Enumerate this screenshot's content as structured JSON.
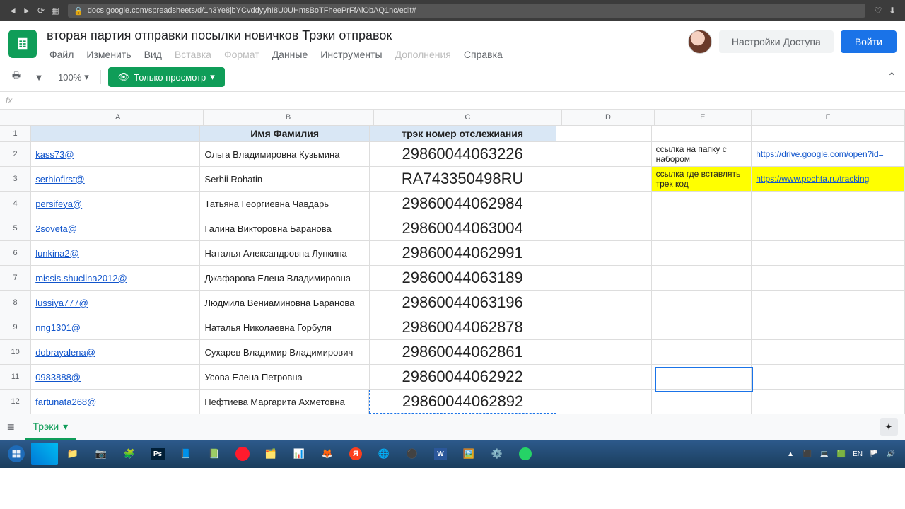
{
  "browser": {
    "url": "docs.google.com/spreadsheets/d/1h3Ye8jbYCvddyyhI8U0UHmsBoTFheePrFfAlObAQ1nc/edit#"
  },
  "doc": {
    "title": "вторая партия отправки посылки новичков Трэки отправок",
    "menus": [
      "Файл",
      "Изменить",
      "Вид",
      "Вставка",
      "Формат",
      "Данные",
      "Инструменты",
      "Дополнения",
      "Справка"
    ],
    "disabled_menus": [
      "Вставка",
      "Формат",
      "Дополнения"
    ],
    "share": "Настройки Доступа",
    "signin": "Войти"
  },
  "toolbar": {
    "zoom": "100%",
    "view_only": "Только просмотр"
  },
  "columns": [
    "A",
    "B",
    "C",
    "D",
    "E",
    "F"
  ],
  "headers": {
    "B": "Имя Фамилия",
    "C": "трэк номер отслежиания"
  },
  "side": {
    "e2": "ссылка на папку с набором",
    "f2": "https://drive.google.com/open?id=",
    "e3": "ссылка где вставлять трек код",
    "f3": "https://www.pochta.ru/tracking"
  },
  "rows": [
    {
      "n": 2,
      "a": "kass73@",
      "b": "Ольга Владимировна Кузьмина",
      "c": "29860044063226"
    },
    {
      "n": 3,
      "a": "serhiofirst@",
      "b": "Serhii Rohatin",
      "c": "RA743350498RU"
    },
    {
      "n": 4,
      "a": "persifeya@",
      "b": "Татьяна Георгиевна Чавдарь",
      "c": "29860044062984"
    },
    {
      "n": 5,
      "a": "2soveta@",
      "b": "Галина Викторовна Баранова",
      "c": "29860044063004"
    },
    {
      "n": 6,
      "a": "lunkina2@",
      "b": "Наталья Александровна Лункина",
      "c": "29860044062991"
    },
    {
      "n": 7,
      "a": "missis.shuclina2012@",
      "b": "Джафарова Елена Владимировна",
      "c": "29860044063189"
    },
    {
      "n": 8,
      "a": "lussiya777@",
      "b": "Людмила Вениаминовна Баранова",
      "c": "29860044063196"
    },
    {
      "n": 9,
      "a": "nng1301@",
      "b": "Наталья Николаевна Горбуля",
      "c": "29860044062878"
    },
    {
      "n": 10,
      "a": "dobrayalena@",
      "b": "Сухарев Владимир Владимирович",
      "c": "29860044062861"
    },
    {
      "n": 11,
      "a": "0983888@",
      "b": "Усова Елена Петровна",
      "c": "29860044062922"
    },
    {
      "n": 12,
      "a": "fartunata268@",
      "b": "Пефтиева Маргарита Ахметовна",
      "c": "29860044062892"
    }
  ],
  "sheet_tab": "Трэки",
  "tray": {
    "lang": "EN",
    "time": "",
    "date": ""
  }
}
